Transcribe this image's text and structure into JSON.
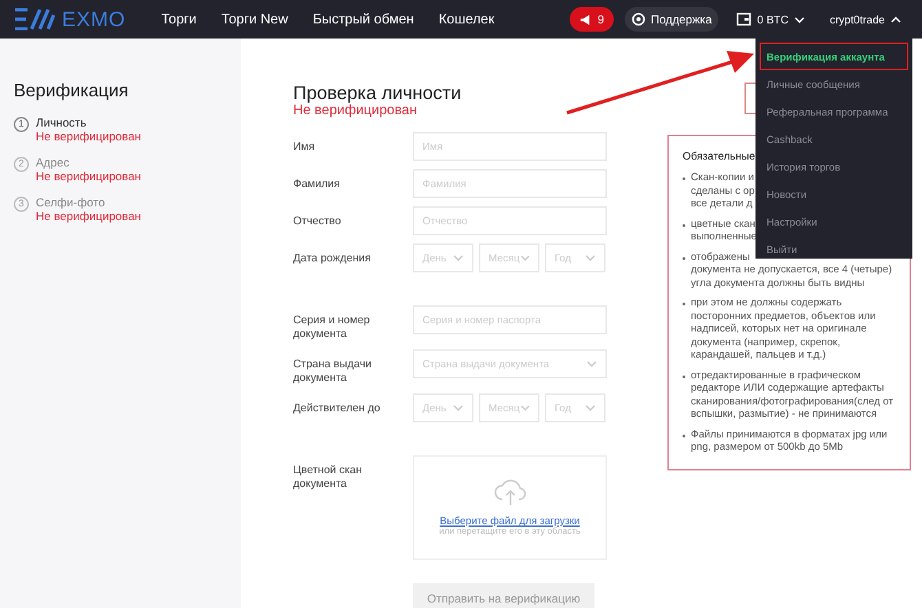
{
  "header": {
    "logo": "EXMO",
    "nav": [
      "Торги",
      "Торги New",
      "Быстрый обмен",
      "Кошелек"
    ],
    "notifications": "9",
    "support": "Поддержка",
    "balance": "0 BTC",
    "user": "crypt0trade"
  },
  "user_menu": [
    {
      "label": "Верификация аккаунта",
      "selected": true
    },
    {
      "label": "Личные сообщения",
      "selected": false
    },
    {
      "label": "Реферальная программа",
      "selected": false
    },
    {
      "label": "Cashback",
      "selected": false
    },
    {
      "label": "История торгов",
      "selected": false
    },
    {
      "label": "Новости",
      "selected": false
    },
    {
      "label": "Настройки",
      "selected": false
    },
    {
      "label": "Выйти",
      "selected": false
    }
  ],
  "sidebar": {
    "title": "Верификация",
    "steps": [
      {
        "number": "1",
        "name": "Личность",
        "status": "Не верифицирован",
        "current": true
      },
      {
        "number": "2",
        "name": "Адрес",
        "status": "Не верифицирован",
        "current": false
      },
      {
        "number": "3",
        "name": "Селфи-фото",
        "status": "Не верифицирован",
        "current": false
      }
    ]
  },
  "form": {
    "title": "Проверка личности",
    "status": "Не верифицирован",
    "fields": [
      {
        "kind": "text",
        "label": "Имя",
        "placeholder": "Имя"
      },
      {
        "kind": "text",
        "label": "Фамилия",
        "placeholder": "Фамилия"
      },
      {
        "kind": "text",
        "label": "Отчество",
        "placeholder": "Отчество"
      },
      {
        "kind": "date",
        "label": "Дата рождения",
        "parts": [
          "День",
          "Месяц",
          "Год"
        ]
      },
      {
        "kind": "text",
        "label": "Серия и номер документа",
        "placeholder": "Серия и номер паспорта"
      },
      {
        "kind": "select",
        "label": "Страна выдачи документа",
        "placeholder": "Страна выдачи документа"
      },
      {
        "kind": "date",
        "label": "Действителен до",
        "parts": [
          "День",
          "Месяц",
          "Год"
        ]
      },
      {
        "kind": "upload",
        "label": "Цветной скан документа",
        "link": "Выберите файл для загрузки",
        "hint": "или перетащите его в эту область"
      }
    ],
    "submit": "Отправить на верификацию"
  },
  "requirements": {
    "title": "Обязательные",
    "items": [
      "Скан-копии и\nсделаны с ор\nвсе детали д",
      "цветные скан\nвыполненные",
      "отображены\nдокумента не допускается, все 4 (четыре)\nугла документа должны быть видны",
      "при этом не должны содержать\nпосторонних предметов, объектов или\nнадписей, которых нет на оригинале\nдокумента (например, скрепок,\nкарандашей, пальцев и т.д.)",
      "отредактированные в графическом\nредакторе ИЛИ содержащие артефакты\nсканирования/фотографирования(след от\nвспышки, размытие) - не принимаются",
      "Файлы принимаются в форматах jpg или\npng, размером от 500kb до 5Mb"
    ]
  }
}
